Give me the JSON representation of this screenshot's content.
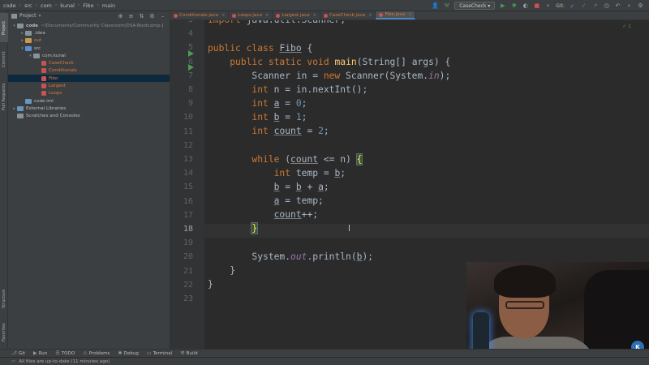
{
  "breadcrumb": [
    "code",
    "src",
    "com",
    "kunal",
    "Fibo",
    "main"
  ],
  "toolbar": {
    "run_config": "CaseCheck",
    "git_label": "Git:"
  },
  "left_tabs": {
    "project": "Project",
    "commit": "Commit",
    "pull_requests": "Pull Requests",
    "structure": "Structure",
    "favorites": "Favorites"
  },
  "project_panel": {
    "title": "Project",
    "items": [
      {
        "label": "code",
        "suffix": "~/Documents/Community Classroom/DSA-Bootcamp-J",
        "kind": "module",
        "indent": 0,
        "arrow": "v"
      },
      {
        "label": ".idea",
        "kind": "folder",
        "indent": 1,
        "arrow": ">"
      },
      {
        "label": "out",
        "kind": "folder-orange",
        "indent": 1,
        "arrow": ">"
      },
      {
        "label": "src",
        "kind": "folder-blue",
        "indent": 1,
        "arrow": "v"
      },
      {
        "label": "com.kunal",
        "kind": "folder",
        "indent": 2,
        "arrow": "v"
      },
      {
        "label": "CaseCheck",
        "kind": "java",
        "indent": 3,
        "arrow": ""
      },
      {
        "label": "Conditionals",
        "kind": "java",
        "indent": 3,
        "arrow": ""
      },
      {
        "label": "Fibo",
        "kind": "java",
        "indent": 3,
        "arrow": "",
        "selected": true
      },
      {
        "label": "Largest",
        "kind": "java",
        "indent": 3,
        "arrow": ""
      },
      {
        "label": "Loops",
        "kind": "java",
        "indent": 3,
        "arrow": ""
      },
      {
        "label": "code.iml",
        "kind": "iml",
        "indent": 1,
        "arrow": ""
      },
      {
        "label": "External Libraries",
        "kind": "lib",
        "indent": 0,
        "arrow": ">"
      },
      {
        "label": "Scratches and Consoles",
        "kind": "scratch",
        "indent": 0,
        "arrow": ""
      }
    ]
  },
  "editor_tabs": [
    {
      "label": "Conditionals.java"
    },
    {
      "label": "Loops.java"
    },
    {
      "label": "Largest.java"
    },
    {
      "label": "CaseCheck.java"
    },
    {
      "label": "Fibo.java",
      "active": true
    }
  ],
  "editor": {
    "line_numbers": [
      "3",
      "4",
      "5",
      "6",
      "7",
      "8",
      "9",
      "10",
      "11",
      "12",
      "13",
      "14",
      "15",
      "16",
      "17",
      "18",
      "19",
      "20",
      "21",
      "22",
      "23"
    ],
    "current_line": "18",
    "inspection": "1"
  },
  "bottom_tools": [
    "Git",
    "Run",
    "TODO",
    "Problems",
    "Debug",
    "Terminal",
    "Build"
  ],
  "status": "All files are up-to-date (11 minutes ago)",
  "webcam_logo": "K",
  "colors": {
    "keyword": "#cc7832",
    "method": "#ffc66d",
    "number": "#6897bb",
    "field": "#9876aa",
    "accent": "#4a88c7"
  }
}
